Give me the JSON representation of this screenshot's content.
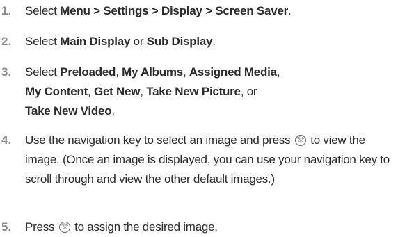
{
  "steps": [
    {
      "number": "1.",
      "parts": {
        "a": "Select ",
        "b": "Menu > Settings > Display > Screen Saver",
        "c": "."
      }
    },
    {
      "number": "2.",
      "parts": {
        "a": "Select ",
        "b": "Main Display",
        "c": " or ",
        "d": "Sub Display",
        "e": "."
      }
    },
    {
      "number": "3.",
      "parts": {
        "a": "Select ",
        "b": "Preloaded",
        "c": ", ",
        "d": "My Albums",
        "e": ", ",
        "f": "Assigned Media",
        "g": ",",
        "h": "My Content",
        "i": ", ",
        "j": "Get New",
        "k": ", ",
        "l": "Take New Picture",
        "m": ", or",
        "n": "Take New Video",
        "o": "."
      }
    },
    {
      "number": "4.",
      "parts": {
        "a": "Use the navigation key to select an image and press ",
        "b": "to view the image. (Once an image is displayed, you can use your navigation key to scroll through and view the other default images.)"
      }
    },
    {
      "number": "5.",
      "parts": {
        "a": "Press ",
        "b": " to assign the desired image."
      }
    }
  ],
  "key_icon": {
    "name": "menu-ok-key-icon",
    "top_text": "MENU",
    "bottom_text": "OK"
  }
}
